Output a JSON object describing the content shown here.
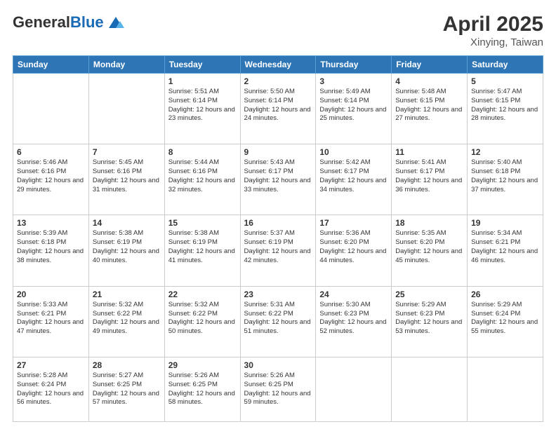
{
  "header": {
    "logo_line1": "General",
    "logo_line2": "Blue",
    "title": "April 2025",
    "location": "Xinying, Taiwan"
  },
  "weekdays": [
    "Sunday",
    "Monday",
    "Tuesday",
    "Wednesday",
    "Thursday",
    "Friday",
    "Saturday"
  ],
  "weeks": [
    [
      {
        "day": "",
        "info": ""
      },
      {
        "day": "",
        "info": ""
      },
      {
        "day": "1",
        "info": "Sunrise: 5:51 AM\nSunset: 6:14 PM\nDaylight: 12 hours and 23 minutes."
      },
      {
        "day": "2",
        "info": "Sunrise: 5:50 AM\nSunset: 6:14 PM\nDaylight: 12 hours and 24 minutes."
      },
      {
        "day": "3",
        "info": "Sunrise: 5:49 AM\nSunset: 6:14 PM\nDaylight: 12 hours and 25 minutes."
      },
      {
        "day": "4",
        "info": "Sunrise: 5:48 AM\nSunset: 6:15 PM\nDaylight: 12 hours and 27 minutes."
      },
      {
        "day": "5",
        "info": "Sunrise: 5:47 AM\nSunset: 6:15 PM\nDaylight: 12 hours and 28 minutes."
      }
    ],
    [
      {
        "day": "6",
        "info": "Sunrise: 5:46 AM\nSunset: 6:16 PM\nDaylight: 12 hours and 29 minutes."
      },
      {
        "day": "7",
        "info": "Sunrise: 5:45 AM\nSunset: 6:16 PM\nDaylight: 12 hours and 31 minutes."
      },
      {
        "day": "8",
        "info": "Sunrise: 5:44 AM\nSunset: 6:16 PM\nDaylight: 12 hours and 32 minutes."
      },
      {
        "day": "9",
        "info": "Sunrise: 5:43 AM\nSunset: 6:17 PM\nDaylight: 12 hours and 33 minutes."
      },
      {
        "day": "10",
        "info": "Sunrise: 5:42 AM\nSunset: 6:17 PM\nDaylight: 12 hours and 34 minutes."
      },
      {
        "day": "11",
        "info": "Sunrise: 5:41 AM\nSunset: 6:17 PM\nDaylight: 12 hours and 36 minutes."
      },
      {
        "day": "12",
        "info": "Sunrise: 5:40 AM\nSunset: 6:18 PM\nDaylight: 12 hours and 37 minutes."
      }
    ],
    [
      {
        "day": "13",
        "info": "Sunrise: 5:39 AM\nSunset: 6:18 PM\nDaylight: 12 hours and 38 minutes."
      },
      {
        "day": "14",
        "info": "Sunrise: 5:38 AM\nSunset: 6:19 PM\nDaylight: 12 hours and 40 minutes."
      },
      {
        "day": "15",
        "info": "Sunrise: 5:38 AM\nSunset: 6:19 PM\nDaylight: 12 hours and 41 minutes."
      },
      {
        "day": "16",
        "info": "Sunrise: 5:37 AM\nSunset: 6:19 PM\nDaylight: 12 hours and 42 minutes."
      },
      {
        "day": "17",
        "info": "Sunrise: 5:36 AM\nSunset: 6:20 PM\nDaylight: 12 hours and 44 minutes."
      },
      {
        "day": "18",
        "info": "Sunrise: 5:35 AM\nSunset: 6:20 PM\nDaylight: 12 hours and 45 minutes."
      },
      {
        "day": "19",
        "info": "Sunrise: 5:34 AM\nSunset: 6:21 PM\nDaylight: 12 hours and 46 minutes."
      }
    ],
    [
      {
        "day": "20",
        "info": "Sunrise: 5:33 AM\nSunset: 6:21 PM\nDaylight: 12 hours and 47 minutes."
      },
      {
        "day": "21",
        "info": "Sunrise: 5:32 AM\nSunset: 6:22 PM\nDaylight: 12 hours and 49 minutes."
      },
      {
        "day": "22",
        "info": "Sunrise: 5:32 AM\nSunset: 6:22 PM\nDaylight: 12 hours and 50 minutes."
      },
      {
        "day": "23",
        "info": "Sunrise: 5:31 AM\nSunset: 6:22 PM\nDaylight: 12 hours and 51 minutes."
      },
      {
        "day": "24",
        "info": "Sunrise: 5:30 AM\nSunset: 6:23 PM\nDaylight: 12 hours and 52 minutes."
      },
      {
        "day": "25",
        "info": "Sunrise: 5:29 AM\nSunset: 6:23 PM\nDaylight: 12 hours and 53 minutes."
      },
      {
        "day": "26",
        "info": "Sunrise: 5:29 AM\nSunset: 6:24 PM\nDaylight: 12 hours and 55 minutes."
      }
    ],
    [
      {
        "day": "27",
        "info": "Sunrise: 5:28 AM\nSunset: 6:24 PM\nDaylight: 12 hours and 56 minutes."
      },
      {
        "day": "28",
        "info": "Sunrise: 5:27 AM\nSunset: 6:25 PM\nDaylight: 12 hours and 57 minutes."
      },
      {
        "day": "29",
        "info": "Sunrise: 5:26 AM\nSunset: 6:25 PM\nDaylight: 12 hours and 58 minutes."
      },
      {
        "day": "30",
        "info": "Sunrise: 5:26 AM\nSunset: 6:25 PM\nDaylight: 12 hours and 59 minutes."
      },
      {
        "day": "",
        "info": ""
      },
      {
        "day": "",
        "info": ""
      },
      {
        "day": "",
        "info": ""
      }
    ]
  ]
}
